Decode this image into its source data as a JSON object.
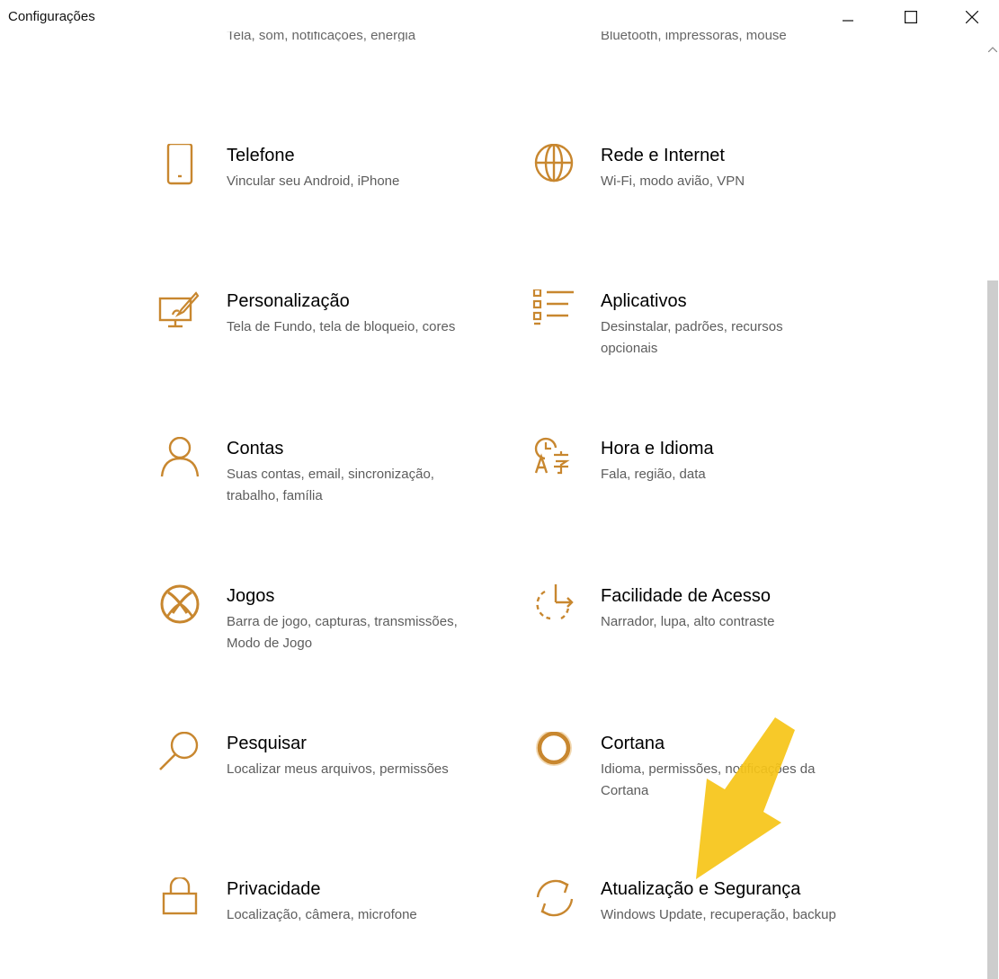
{
  "window": {
    "title": "Configurações"
  },
  "cutoff_row": {
    "left_desc": "Tela, som, notificações, energia",
    "right_desc": "Bluetooth, impressoras, mouse"
  },
  "tiles": [
    {
      "label": "Telefone",
      "desc": "Vincular seu Android, iPhone",
      "icon": "phone-icon"
    },
    {
      "label": "Rede e Internet",
      "desc": "Wi-Fi, modo avião, VPN",
      "icon": "globe-icon"
    },
    {
      "label": "Personalização",
      "desc": "Tela de Fundo, tela de bloqueio, cores",
      "icon": "paint-brush-icon"
    },
    {
      "label": "Aplicativos",
      "desc": "Desinstalar, padrões, recursos opcionais",
      "icon": "apps-list-icon"
    },
    {
      "label": "Contas",
      "desc": "Suas contas, email, sincronização, trabalho, família",
      "icon": "person-icon"
    },
    {
      "label": "Hora e Idioma",
      "desc": "Fala, região, data",
      "icon": "time-language-icon"
    },
    {
      "label": "Jogos",
      "desc": "Barra de jogo, capturas, transmissões, Modo de Jogo",
      "icon": "xbox-icon"
    },
    {
      "label": "Facilidade de Acesso",
      "desc": "Narrador, lupa, alto contraste",
      "icon": "ease-of-access-icon"
    },
    {
      "label": "Pesquisar",
      "desc": "Localizar meus arquivos, permissões",
      "icon": "search-icon"
    },
    {
      "label": "Cortana",
      "desc": "Idioma, permissões, notificações da Cortana",
      "icon": "cortana-icon"
    },
    {
      "label": "Privacidade",
      "desc": "Localização, câmera, microfone",
      "icon": "lock-icon"
    },
    {
      "label": "Atualização e Segurança",
      "desc": "Windows Update, recuperação, backup",
      "icon": "sync-icon"
    }
  ],
  "colors": {
    "accent": "#C8872F",
    "arrow": "#F6C417",
    "desc_text": "#5D5D5D",
    "scroll_thumb": "#CDCDCD"
  }
}
